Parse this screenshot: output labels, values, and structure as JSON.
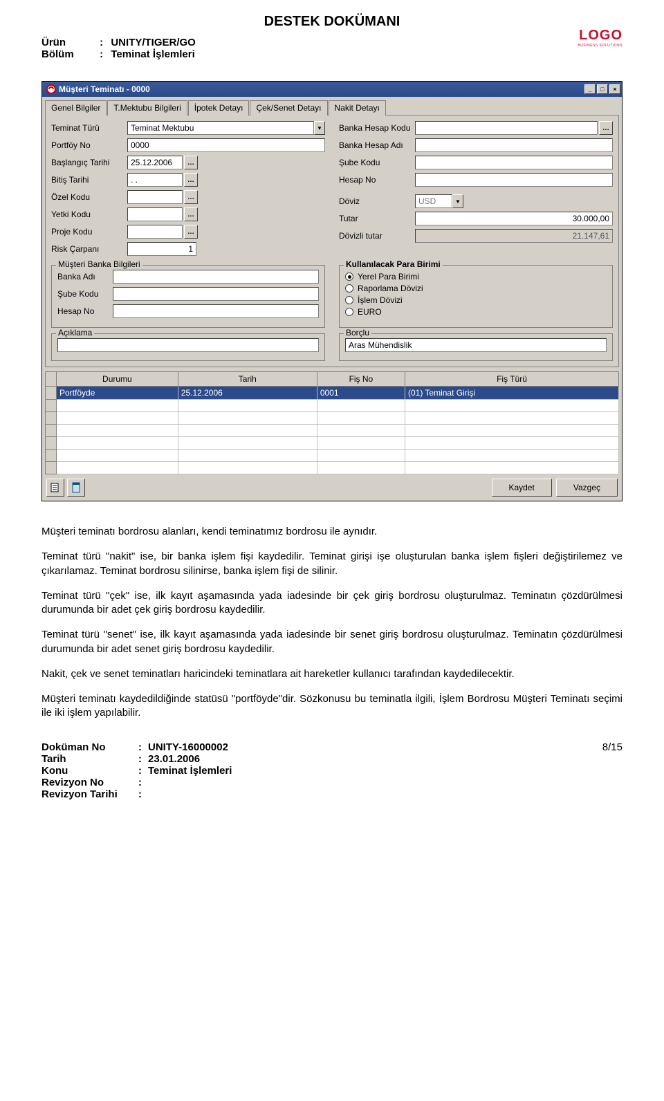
{
  "doc": {
    "title": "DESTEK DOKÜMANI",
    "urun_label": "Ürün",
    "urun_value": "UNITY/TIGER/GO",
    "bolum_label": "Bölüm",
    "bolum_value": "Teminat İşlemleri",
    "logo_main": "LOGO",
    "logo_sub": "BUSINESS SOLUTIONS"
  },
  "window": {
    "title": "Müşteri Teminatı - 0000",
    "tabs": [
      "Genel Bilgiler",
      "T.Mektubu Bilgileri",
      "İpotek Detayı",
      "Çek/Senet Detayı",
      "Nakit Detayı"
    ],
    "left_fields": {
      "teminat_turu_label": "Teminat Türü",
      "teminat_turu_value": "Teminat Mektubu",
      "portfoy_label": "Portföy No",
      "portfoy_value": "0000",
      "baslangic_label": "Başlangıç Tarihi",
      "baslangic_value": "25.12.2006",
      "bitis_label": "Bitiş Tarihi",
      "bitis_value": ". .",
      "ozel_label": "Özel Kodu",
      "yetki_label": "Yetki Kodu",
      "proje_label": "Proje Kodu",
      "risk_label": "Risk Çarpanı",
      "risk_value": "1"
    },
    "right_fields": {
      "bhk_label": "Banka Hesap Kodu",
      "bha_label": "Banka Hesap Adı",
      "sube_label": "Şube Kodu",
      "hesap_label": "Hesap No",
      "doviz_label": "Döviz",
      "doviz_value": "USD",
      "tutar_label": "Tutar",
      "tutar_value": "30.000,00",
      "dtutar_label": "Dövizli tutar",
      "dtutar_value": "21.147,61"
    },
    "musteri_banka": {
      "title": "Müşteri Banka Bilgileri",
      "banka_adi": "Banka Adı",
      "sube_kodu": "Şube Kodu",
      "hesap_no": "Hesap No"
    },
    "para_birimi": {
      "title": "Kullanılacak Para Birimi",
      "opts": [
        "Yerel Para Birimi",
        "Raporlama Dövizi",
        "İşlem Dövizi",
        "EURO"
      ]
    },
    "aciklama": {
      "title": "Açıklama"
    },
    "borclu": {
      "title": "Borçlu",
      "value": "Aras Mühendislik"
    },
    "grid": {
      "headers": [
        "Durumu",
        "Tarih",
        "Fiş No",
        "Fiş Türü"
      ],
      "row": [
        "Portföyde",
        "25.12.2006",
        "0001",
        "(01) Teminat Girişi"
      ]
    },
    "buttons": {
      "save": "Kaydet",
      "cancel": "Vazgeç"
    }
  },
  "paragraphs": [
    "Müşteri teminatı bordrosu alanları, kendi teminatımız bordrosu ile aynıdır.",
    "Teminat türü \"nakit\" ise, bir banka işlem fişi kaydedilir. Teminat girişi işe oluşturulan banka işlem fişleri değiştirilemez ve çıkarılamaz. Teminat bordrosu silinirse, banka işlem fişi de silinir.",
    "Teminat türü \"çek\" ise, ilk kayıt aşamasında yada iadesinde bir çek giriş bordrosu oluşturulmaz. Teminatın çözdürülmesi durumunda bir adet çek giriş bordrosu kaydedilir.",
    "Teminat türü \"senet\" ise, ilk kayıt aşamasında yada iadesinde bir senet giriş bordrosu oluşturulmaz. Teminatın çözdürülmesi durumunda bir adet senet giriş bordrosu kaydedilir.",
    "Nakit, çek ve senet teminatları haricindeki teminatlara ait hareketler kullanıcı tarafından kaydedilecektir.",
    "Müşteri teminatı kaydedildiğinde statüsü \"portföyde\"dir. Sözkonusu bu teminatla ilgili, İşlem Bordrosu Müşteri Teminatı seçimi ile iki işlem yapılabilir."
  ],
  "footer": {
    "dokuman_no_label": "Doküman No",
    "dokuman_no_value": "UNITY-16000002",
    "tarih_label": "Tarih",
    "tarih_value": "23.01.2006",
    "konu_label": "Konu",
    "konu_value": "Teminat İşlemleri",
    "rev_no_label": "Revizyon No",
    "rev_tarih_label": "Revizyon Tarihi",
    "page": "8/15"
  }
}
